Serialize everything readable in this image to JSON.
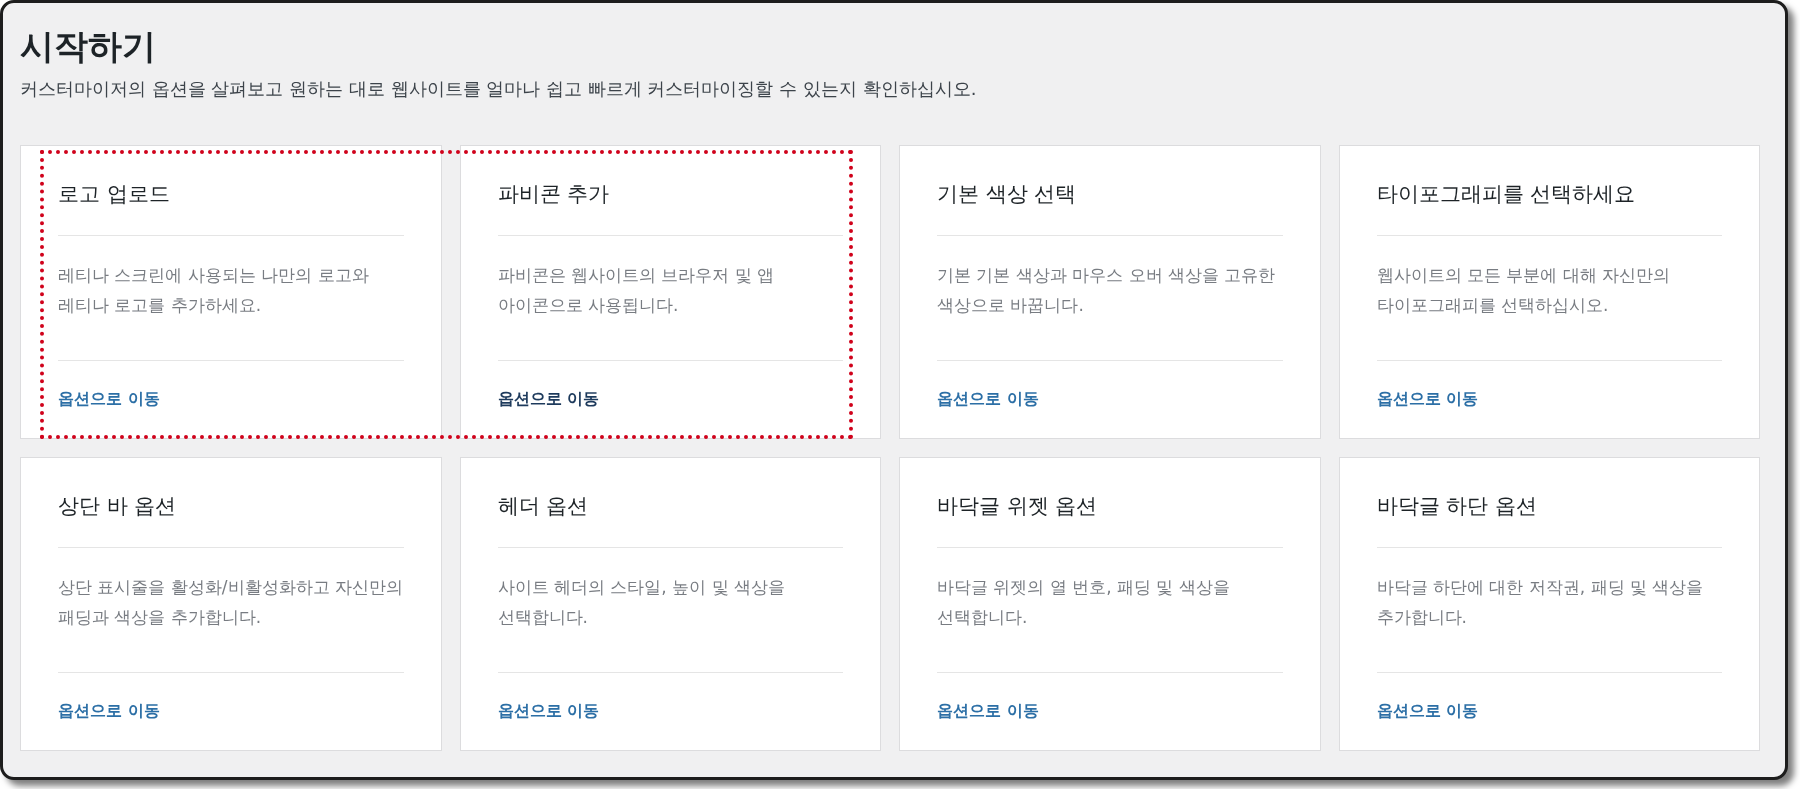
{
  "heading": "시작하기",
  "intro": "커스터마이저의 옵션을 살펴보고 원하는 대로 웹사이트를 얼마나 쉽고 빠르게 커스터마이징할 수 있는지 확인하십시오.",
  "cards": [
    {
      "title": "로고 업로드",
      "description": "레티나 스크린에 사용되는 나만의 로고와 레티나 로고를 추가하세요.",
      "link": "옵션으로 이동",
      "highlighted": true,
      "link_hovered": false
    },
    {
      "title": "파비콘 추가",
      "description": "파비콘은 웹사이트의 브라우저 및 앱 아이콘으로 사용됩니다.",
      "link": "옵션으로 이동",
      "highlighted": true,
      "link_hovered": true
    },
    {
      "title": "기본 색상 선택",
      "description": "기본 기본 색상과 마우스 오버 색상을 고유한 색상으로 바꿉니다.",
      "link": "옵션으로 이동",
      "highlighted": false,
      "link_hovered": false
    },
    {
      "title": "타이포그래피를 선택하세요",
      "description": "웹사이트의 모든 부분에 대해 자신만의 타이포그래피를 선택하십시오.",
      "link": "옵션으로 이동",
      "highlighted": false,
      "link_hovered": false
    },
    {
      "title": "상단 바 옵션",
      "description": "상단 표시줄을 활성화/비활성화하고 자신만의 패딩과 색상을 추가합니다.",
      "link": "옵션으로 이동",
      "highlighted": false,
      "link_hovered": false
    },
    {
      "title": "헤더 옵션",
      "description": "사이트 헤더의 스타일, 높이 및 색상을 선택합니다.",
      "link": "옵션으로 이동",
      "highlighted": false,
      "link_hovered": false
    },
    {
      "title": "바닥글 위젯 옵션",
      "description": "바닥글 위젯의 열 번호, 패딩 및 색상을 선택합니다.",
      "link": "옵션으로 이동",
      "highlighted": false,
      "link_hovered": false
    },
    {
      "title": "바닥글 하단 옵션",
      "description": "바닥글 하단에 대한 저작권, 패딩 및 색상을 추가합니다.",
      "link": "옵션으로 이동",
      "highlighted": false,
      "link_hovered": false
    }
  ]
}
